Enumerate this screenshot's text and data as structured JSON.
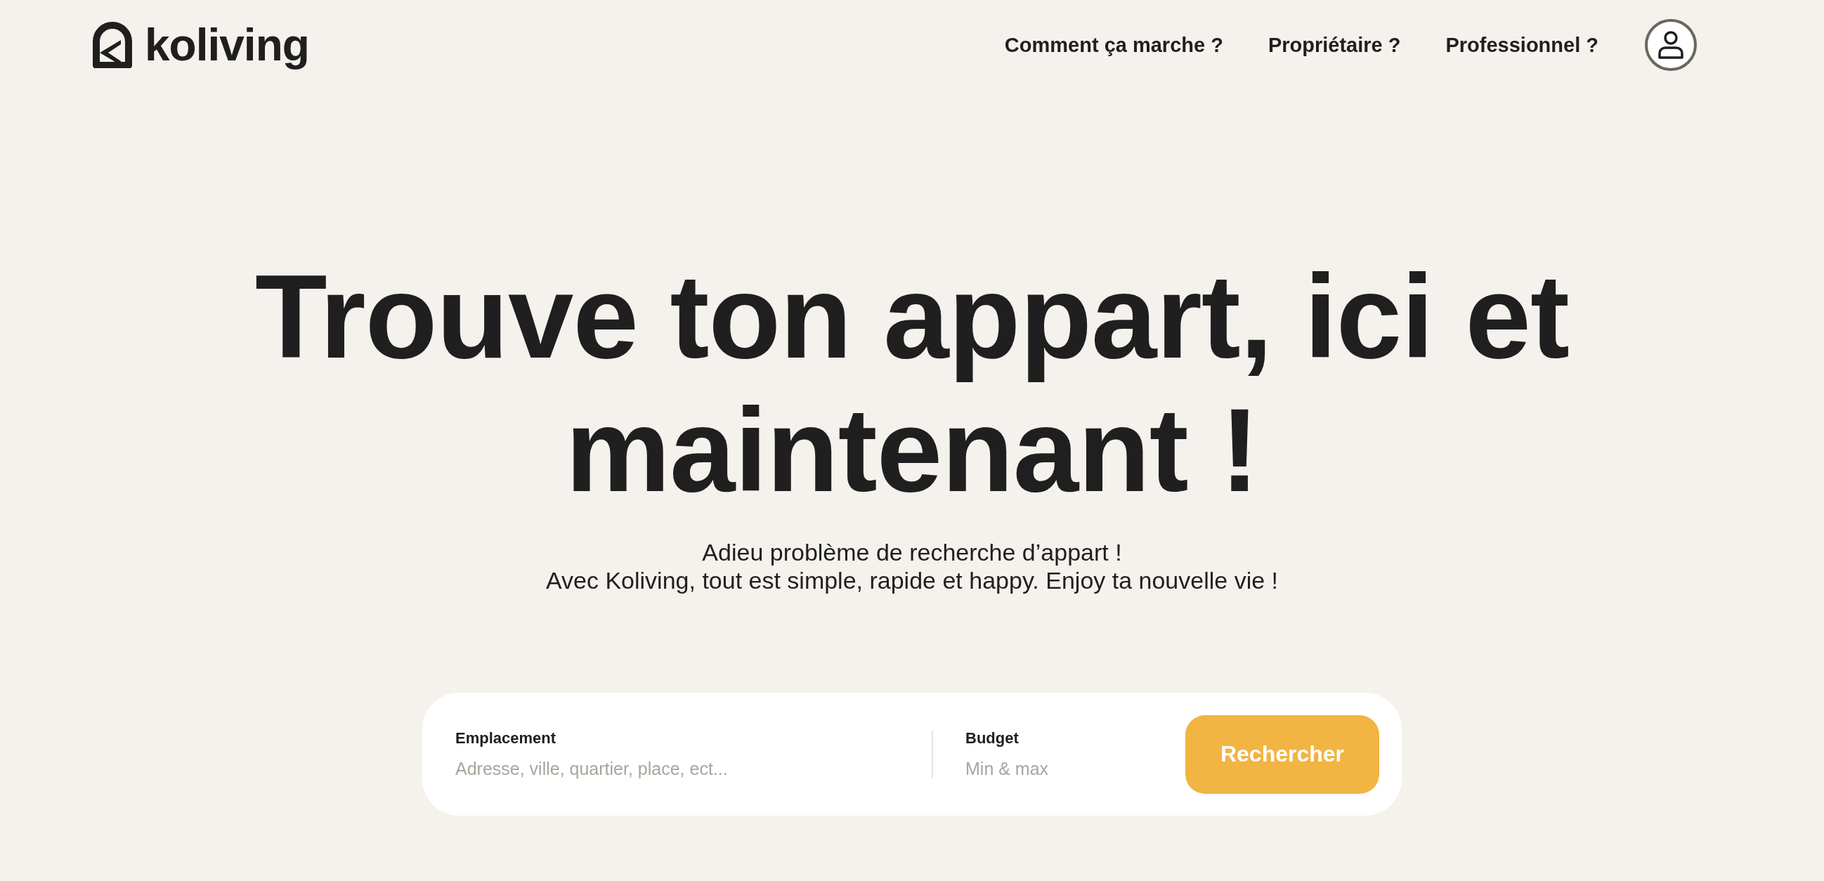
{
  "header": {
    "logo_text": "koliving",
    "nav": [
      {
        "label": "Comment ça marche ?"
      },
      {
        "label": "Propriétaire ?"
      },
      {
        "label": "Professionnel ?"
      }
    ]
  },
  "hero": {
    "title": "Trouve ton appart, ici et maintenant !",
    "subtitle": "Adieu problème de recherche d’appart !\nAvec Koliving, tout est simple, rapide et happy. Enjoy ta nouvelle vie !"
  },
  "search": {
    "fields": [
      {
        "label": "Emplacement",
        "placeholder": "Adresse, ville, quartier, place, ect..."
      },
      {
        "label": "Budget",
        "placeholder": "Min & max"
      }
    ],
    "button": "Rechercher"
  }
}
